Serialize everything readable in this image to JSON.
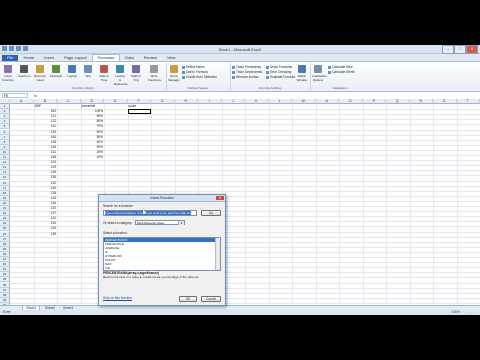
{
  "window": {
    "title": "Book1 - Microsoft Excel",
    "minimize": "–",
    "maximize": "□",
    "close": "✕"
  },
  "ribbon": {
    "tabs": [
      "File",
      "Home",
      "Insert",
      "Page Layout",
      "Formulas",
      "Data",
      "Review",
      "View"
    ],
    "active_tab": "Formulas",
    "groups": {
      "function_library": "Function Library",
      "defined_names": "Defined Names",
      "formula_auditing": "Formula Auditing",
      "calculation": "Calculation"
    },
    "buttons": {
      "insert_function": "Insert Function",
      "autosum": "AutoSum",
      "recently_used": "Recently Used",
      "financial": "Financial",
      "logical": "Logical",
      "text": "Text",
      "date_time": "Date & Time",
      "lookup_reference": "Lookup & Reference",
      "math_trig": "Math & Trig",
      "more_functions": "More Functions",
      "name_manager": "Name Manager",
      "define_name": "Define Name",
      "use_in_formula": "Use in Formula",
      "create_from_selection": "Create from Selection",
      "trace_precedents": "Trace Precedents",
      "trace_dependents": "Trace Dependents",
      "remove_arrows": "Remove Arrows",
      "show_formulas": "Show Formulas",
      "error_checking": "Error Checking",
      "evaluate_formula": "Evaluate Formula",
      "watch_window": "Watch Window",
      "calculation_options": "Calculation Options",
      "calculate_now": "Calculate Now",
      "calculate_sheet": "Calculate Sheet"
    }
  },
  "formula_bar": {
    "name_box": "F5",
    "fx": "fx"
  },
  "columns": [
    "A",
    "B",
    "C",
    "D",
    "E",
    "F",
    "G",
    "H",
    "I",
    "J",
    "K",
    "L",
    "M",
    "N",
    "O",
    "P",
    "Q",
    "R",
    "S",
    "T"
  ],
  "headers": {
    "B1": "SBP",
    "D1": "percentile",
    "F1": "score"
  },
  "rows": [
    {
      "n": "1",
      "b": "",
      "d": ""
    },
    {
      "n": "2",
      "b": "160",
      "d": "100%"
    },
    {
      "n": "3",
      "b": "121",
      "d": "90%"
    },
    {
      "n": "4",
      "b": "122",
      "d": "80%"
    },
    {
      "n": "5",
      "b": "131",
      "d": "70%"
    },
    {
      "n": "6",
      "b": "133",
      "d": "60%"
    },
    {
      "n": "7",
      "b": "160",
      "d": "50%"
    },
    {
      "n": "8",
      "b": "138",
      "d": "40%"
    },
    {
      "n": "9",
      "b": "125",
      "d": "30%"
    },
    {
      "n": "10",
      "b": "131",
      "d": "20%"
    },
    {
      "n": "11",
      "b": "148",
      "d": "10%"
    },
    {
      "n": "12",
      "b": "124",
      "d": ""
    },
    {
      "n": "13",
      "b": "129",
      "d": ""
    },
    {
      "n": "14",
      "b": "118",
      "d": ""
    },
    {
      "n": "15",
      "b": "136",
      "d": ""
    },
    {
      "n": "16",
      "b": "132",
      "d": ""
    },
    {
      "n": "17",
      "b": "140",
      "d": ""
    },
    {
      "n": "18",
      "b": "128",
      "d": ""
    },
    {
      "n": "19",
      "b": "144",
      "d": ""
    },
    {
      "n": "20",
      "b": "126",
      "d": ""
    },
    {
      "n": "21",
      "b": "120",
      "d": ""
    },
    {
      "n": "22",
      "b": "137",
      "d": ""
    },
    {
      "n": "23",
      "b": "142",
      "d": ""
    },
    {
      "n": "24",
      "b": "130",
      "d": ""
    },
    {
      "n": "25",
      "b": "134",
      "d": ""
    },
    {
      "n": "26",
      "b": "139",
      "d": ""
    },
    {
      "n": "27",
      "b": "",
      "d": ""
    },
    {
      "n": "28",
      "b": "",
      "d": ""
    },
    {
      "n": "29",
      "b": "",
      "d": ""
    },
    {
      "n": "30",
      "b": "",
      "d": ""
    },
    {
      "n": "31",
      "b": "",
      "d": ""
    },
    {
      "n": "32",
      "b": "",
      "d": ""
    },
    {
      "n": "33",
      "b": "",
      "d": ""
    },
    {
      "n": "34",
      "b": "",
      "d": ""
    },
    {
      "n": "35",
      "b": "",
      "d": ""
    },
    {
      "n": "36",
      "b": "",
      "d": ""
    },
    {
      "n": "37",
      "b": "",
      "d": ""
    },
    {
      "n": "38",
      "b": "",
      "d": ""
    },
    {
      "n": "39",
      "b": "",
      "d": ""
    },
    {
      "n": "40",
      "b": "",
      "d": ""
    }
  ],
  "sheets": [
    "Sheet1",
    "Sheet2",
    "Sheet3"
  ],
  "status": {
    "left": "Enter",
    "zoom": "100%"
  },
  "dialog": {
    "title": "Insert Function",
    "close": "✕",
    "search_label": "Search for a function:",
    "search_value": "Type a brief description of what you want to do and then click Go",
    "go": "Go",
    "category_label": "Or select a category:",
    "category_value": "Most Recently Used",
    "select_label": "Select a function:",
    "functions": [
      "PERCENTRANK",
      "PERCENTILE",
      "AVERAGE",
      "IF",
      "HYPERLINK",
      "COUNT",
      "MAX",
      "SIN",
      "SUMIF"
    ],
    "selected_function": "PERCENTRANK",
    "signature": "PERCENTRANK(array,x,significance)",
    "description": "Returns the rank of a value in a data set as a percentage of the data set.",
    "help_link": "Help on this function",
    "ok": "OK",
    "cancel": "Cancel"
  },
  "taskbar": {
    "time": "1:48 PM"
  }
}
